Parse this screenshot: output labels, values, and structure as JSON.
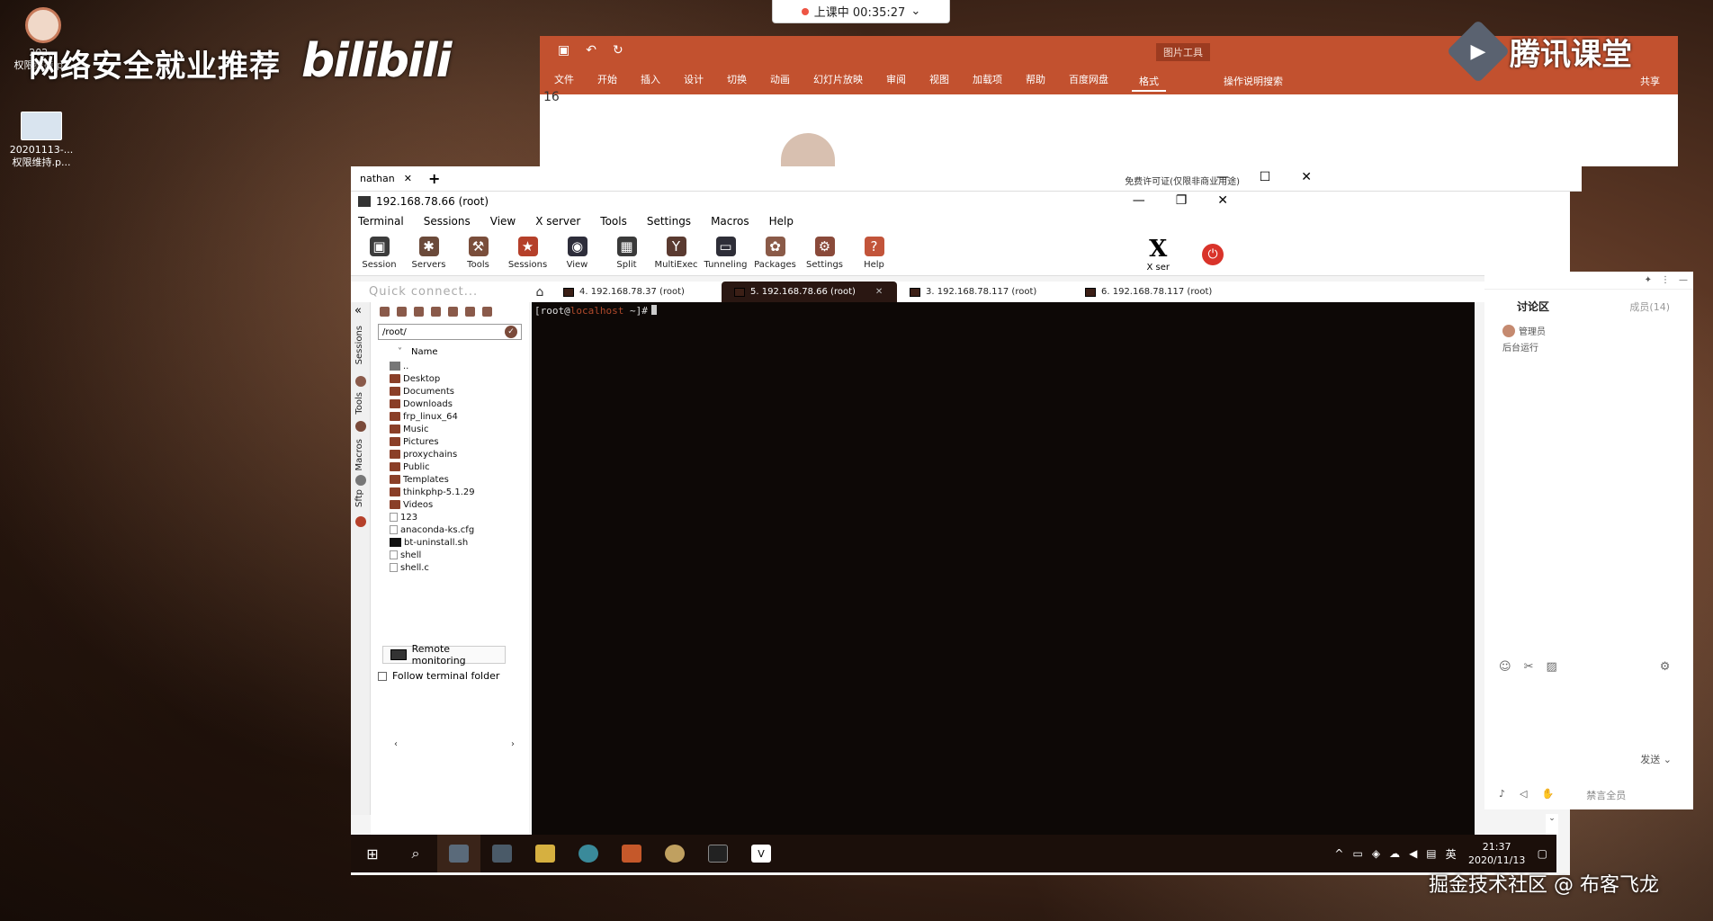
{
  "timer": "上课中 00:35:27",
  "desktop": {
    "overlay_title": "网络安全就业推荐",
    "logo": "bilibili",
    "icons": [
      {
        "line1": "202...",
        "line2": "权限维持.p..."
      },
      {
        "line1": "20201113-...",
        "line2": "权限维持.p..."
      }
    ]
  },
  "ppt": {
    "tencent_name": "腾讯课堂",
    "tools_tag": "图片工具",
    "tabs": [
      "文件",
      "开始",
      "插入",
      "设计",
      "切换",
      "动画",
      "幻灯片放映",
      "审阅",
      "视图",
      "加载项",
      "帮助",
      "百度网盘",
      "格式"
    ],
    "selected_tab": "格式",
    "search": "操作说明搜索",
    "share": "共享",
    "slide_num": "16"
  },
  "host": {
    "tab_label": "nathan",
    "license": "免费许可证(仅限非商业用途)"
  },
  "moba": {
    "title": "192.168.78.66 (root)",
    "menu": [
      "Terminal",
      "Sessions",
      "View",
      "X server",
      "Tools",
      "Settings",
      "Macros",
      "Help"
    ],
    "toolbar": [
      {
        "label": "Session",
        "icon": "session-icon",
        "glyph": "▣",
        "color": "#3c3c3c"
      },
      {
        "label": "Servers",
        "icon": "servers-icon",
        "glyph": "✱",
        "color": "#6b4a3a"
      },
      {
        "label": "Tools",
        "icon": "tools-icon",
        "glyph": "⚒",
        "color": "#7a4e3b"
      },
      {
        "label": "Sessions",
        "icon": "sessions-star-icon",
        "glyph": "★",
        "color": "#b5402a"
      },
      {
        "label": "View",
        "icon": "view-icon",
        "glyph": "◉",
        "color": "#2d2d3a"
      },
      {
        "label": "Split",
        "icon": "split-icon",
        "glyph": "▦",
        "color": "#3a3a3a"
      },
      {
        "label": "MultiExec",
        "icon": "multiexec-icon",
        "glyph": "Y",
        "color": "#5a3a30"
      },
      {
        "label": "Tunneling",
        "icon": "tunneling-icon",
        "glyph": "▭",
        "color": "#2e2e38"
      },
      {
        "label": "Packages",
        "icon": "packages-icon",
        "glyph": "✿",
        "color": "#8a5a48"
      },
      {
        "label": "Settings",
        "icon": "settings-icon",
        "glyph": "⚙",
        "color": "#8a4a3a"
      },
      {
        "label": "Help",
        "icon": "help-icon",
        "glyph": "?",
        "color": "#c2543a"
      }
    ],
    "xserver_label": "X ser",
    "quick_connect": "Quick connect...",
    "session_tabs": [
      {
        "label": "4. 192.168.78.37 (root)",
        "active": false
      },
      {
        "label": "5. 192.168.78.66 (root)",
        "active": true
      },
      {
        "label": "3. 192.168.78.117 (root)",
        "active": false
      },
      {
        "label": "6. 192.168.78.117 (root)",
        "active": false
      }
    ],
    "side_labels": [
      "Sessions",
      "Tools",
      "Macros",
      "Sftp"
    ],
    "path": "/root/",
    "column_name": "Name",
    "files": [
      {
        "name": "..",
        "type": "up"
      },
      {
        "name": "Desktop",
        "type": "folder"
      },
      {
        "name": "Documents",
        "type": "folder"
      },
      {
        "name": "Downloads",
        "type": "folder"
      },
      {
        "name": "frp_linux_64",
        "type": "folder"
      },
      {
        "name": "Music",
        "type": "folder"
      },
      {
        "name": "Pictures",
        "type": "folder"
      },
      {
        "name": "proxychains",
        "type": "folder"
      },
      {
        "name": "Public",
        "type": "folder"
      },
      {
        "name": "Templates",
        "type": "folder"
      },
      {
        "name": "thinkphp-5.1.29",
        "type": "folder"
      },
      {
        "name": "Videos",
        "type": "folder"
      },
      {
        "name": "123",
        "type": "doc"
      },
      {
        "name": "anaconda-ks.cfg",
        "type": "doc"
      },
      {
        "name": "bt-uninstall.sh",
        "type": "exe"
      },
      {
        "name": "shell",
        "type": "doc"
      },
      {
        "name": "shell.c",
        "type": "doc"
      }
    ],
    "remote_monitoring": "Remote monitoring",
    "follow_folder": "Follow terminal folder",
    "terminal": {
      "open": "[root@",
      "host": "localhost",
      "rest": " ~]#"
    }
  },
  "chat": {
    "title": "讨论区",
    "members": "成员(14)",
    "msg_user": "管理员",
    "msg_text": "后台运行",
    "send": "发送",
    "disabled": "禁言全员"
  },
  "taskbar": {
    "ime": "英",
    "time": "21:37",
    "date": "2020/11/13"
  },
  "watermark": "掘金技术社区 @ 布客飞龙"
}
